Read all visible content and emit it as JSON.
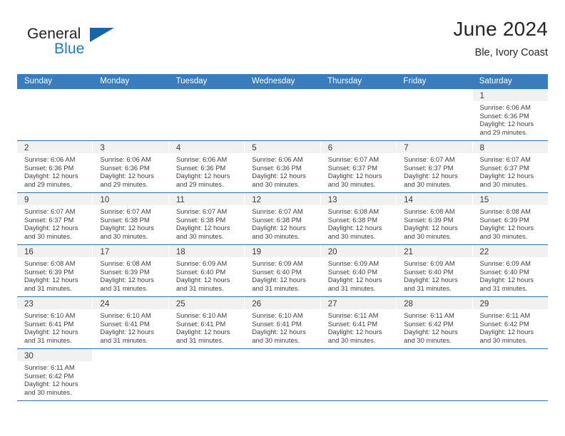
{
  "brand": {
    "name_part1": "General",
    "name_part2": "Blue",
    "flag_icon": "blue-triangle-flag-icon"
  },
  "header": {
    "title": "June 2024",
    "subtitle": "Ble, Ivory Coast"
  },
  "colors": {
    "header_blue": "#3a7dbf",
    "rule_blue": "#2f6fa8",
    "brand_blue": "#1f7ac0",
    "day_band_gray": "#f1f1f1",
    "text": "#3f3f3f"
  },
  "weekday_headers": [
    "Sunday",
    "Monday",
    "Tuesday",
    "Wednesday",
    "Thursday",
    "Friday",
    "Saturday"
  ],
  "weeks": [
    [
      {
        "day": "",
        "sunrise": "",
        "sunset": "",
        "daylight1": "",
        "daylight2": "",
        "blank": true
      },
      {
        "day": "",
        "sunrise": "",
        "sunset": "",
        "daylight1": "",
        "daylight2": "",
        "blank": true
      },
      {
        "day": "",
        "sunrise": "",
        "sunset": "",
        "daylight1": "",
        "daylight2": "",
        "blank": true
      },
      {
        "day": "",
        "sunrise": "",
        "sunset": "",
        "daylight1": "",
        "daylight2": "",
        "blank": true
      },
      {
        "day": "",
        "sunrise": "",
        "sunset": "",
        "daylight1": "",
        "daylight2": "",
        "blank": true
      },
      {
        "day": "",
        "sunrise": "",
        "sunset": "",
        "daylight1": "",
        "daylight2": "",
        "blank": true
      },
      {
        "day": "1",
        "sunrise": "Sunrise: 6:06 AM",
        "sunset": "Sunset: 6:36 PM",
        "daylight1": "Daylight: 12 hours",
        "daylight2": "and 29 minutes.",
        "blank": false
      }
    ],
    [
      {
        "day": "2",
        "sunrise": "Sunrise: 6:06 AM",
        "sunset": "Sunset: 6:36 PM",
        "daylight1": "Daylight: 12 hours",
        "daylight2": "and 29 minutes.",
        "blank": false
      },
      {
        "day": "3",
        "sunrise": "Sunrise: 6:06 AM",
        "sunset": "Sunset: 6:36 PM",
        "daylight1": "Daylight: 12 hours",
        "daylight2": "and 29 minutes.",
        "blank": false
      },
      {
        "day": "4",
        "sunrise": "Sunrise: 6:06 AM",
        "sunset": "Sunset: 6:36 PM",
        "daylight1": "Daylight: 12 hours",
        "daylight2": "and 29 minutes.",
        "blank": false
      },
      {
        "day": "5",
        "sunrise": "Sunrise: 6:06 AM",
        "sunset": "Sunset: 6:36 PM",
        "daylight1": "Daylight: 12 hours",
        "daylight2": "and 30 minutes.",
        "blank": false
      },
      {
        "day": "6",
        "sunrise": "Sunrise: 6:07 AM",
        "sunset": "Sunset: 6:37 PM",
        "daylight1": "Daylight: 12 hours",
        "daylight2": "and 30 minutes.",
        "blank": false
      },
      {
        "day": "7",
        "sunrise": "Sunrise: 6:07 AM",
        "sunset": "Sunset: 6:37 PM",
        "daylight1": "Daylight: 12 hours",
        "daylight2": "and 30 minutes.",
        "blank": false
      },
      {
        "day": "8",
        "sunrise": "Sunrise: 6:07 AM",
        "sunset": "Sunset: 6:37 PM",
        "daylight1": "Daylight: 12 hours",
        "daylight2": "and 30 minutes.",
        "blank": false
      }
    ],
    [
      {
        "day": "9",
        "sunrise": "Sunrise: 6:07 AM",
        "sunset": "Sunset: 6:37 PM",
        "daylight1": "Daylight: 12 hours",
        "daylight2": "and 30 minutes.",
        "blank": false
      },
      {
        "day": "10",
        "sunrise": "Sunrise: 6:07 AM",
        "sunset": "Sunset: 6:38 PM",
        "daylight1": "Daylight: 12 hours",
        "daylight2": "and 30 minutes.",
        "blank": false
      },
      {
        "day": "11",
        "sunrise": "Sunrise: 6:07 AM",
        "sunset": "Sunset: 6:38 PM",
        "daylight1": "Daylight: 12 hours",
        "daylight2": "and 30 minutes.",
        "blank": false
      },
      {
        "day": "12",
        "sunrise": "Sunrise: 6:07 AM",
        "sunset": "Sunset: 6:38 PM",
        "daylight1": "Daylight: 12 hours",
        "daylight2": "and 30 minutes.",
        "blank": false
      },
      {
        "day": "13",
        "sunrise": "Sunrise: 6:08 AM",
        "sunset": "Sunset: 6:38 PM",
        "daylight1": "Daylight: 12 hours",
        "daylight2": "and 30 minutes.",
        "blank": false
      },
      {
        "day": "14",
        "sunrise": "Sunrise: 6:08 AM",
        "sunset": "Sunset: 6:39 PM",
        "daylight1": "Daylight: 12 hours",
        "daylight2": "and 30 minutes.",
        "blank": false
      },
      {
        "day": "15",
        "sunrise": "Sunrise: 6:08 AM",
        "sunset": "Sunset: 6:39 PM",
        "daylight1": "Daylight: 12 hours",
        "daylight2": "and 30 minutes.",
        "blank": false
      }
    ],
    [
      {
        "day": "16",
        "sunrise": "Sunrise: 6:08 AM",
        "sunset": "Sunset: 6:39 PM",
        "daylight1": "Daylight: 12 hours",
        "daylight2": "and 31 minutes.",
        "blank": false
      },
      {
        "day": "17",
        "sunrise": "Sunrise: 6:08 AM",
        "sunset": "Sunset: 6:39 PM",
        "daylight1": "Daylight: 12 hours",
        "daylight2": "and 31 minutes.",
        "blank": false
      },
      {
        "day": "18",
        "sunrise": "Sunrise: 6:09 AM",
        "sunset": "Sunset: 6:40 PM",
        "daylight1": "Daylight: 12 hours",
        "daylight2": "and 31 minutes.",
        "blank": false
      },
      {
        "day": "19",
        "sunrise": "Sunrise: 6:09 AM",
        "sunset": "Sunset: 6:40 PM",
        "daylight1": "Daylight: 12 hours",
        "daylight2": "and 31 minutes.",
        "blank": false
      },
      {
        "day": "20",
        "sunrise": "Sunrise: 6:09 AM",
        "sunset": "Sunset: 6:40 PM",
        "daylight1": "Daylight: 12 hours",
        "daylight2": "and 31 minutes.",
        "blank": false
      },
      {
        "day": "21",
        "sunrise": "Sunrise: 6:09 AM",
        "sunset": "Sunset: 6:40 PM",
        "daylight1": "Daylight: 12 hours",
        "daylight2": "and 31 minutes.",
        "blank": false
      },
      {
        "day": "22",
        "sunrise": "Sunrise: 6:09 AM",
        "sunset": "Sunset: 6:40 PM",
        "daylight1": "Daylight: 12 hours",
        "daylight2": "and 31 minutes.",
        "blank": false
      }
    ],
    [
      {
        "day": "23",
        "sunrise": "Sunrise: 6:10 AM",
        "sunset": "Sunset: 6:41 PM",
        "daylight1": "Daylight: 12 hours",
        "daylight2": "and 31 minutes.",
        "blank": false
      },
      {
        "day": "24",
        "sunrise": "Sunrise: 6:10 AM",
        "sunset": "Sunset: 6:41 PM",
        "daylight1": "Daylight: 12 hours",
        "daylight2": "and 31 minutes.",
        "blank": false
      },
      {
        "day": "25",
        "sunrise": "Sunrise: 6:10 AM",
        "sunset": "Sunset: 6:41 PM",
        "daylight1": "Daylight: 12 hours",
        "daylight2": "and 31 minutes.",
        "blank": false
      },
      {
        "day": "26",
        "sunrise": "Sunrise: 6:10 AM",
        "sunset": "Sunset: 6:41 PM",
        "daylight1": "Daylight: 12 hours",
        "daylight2": "and 30 minutes.",
        "blank": false
      },
      {
        "day": "27",
        "sunrise": "Sunrise: 6:11 AM",
        "sunset": "Sunset: 6:41 PM",
        "daylight1": "Daylight: 12 hours",
        "daylight2": "and 30 minutes.",
        "blank": false
      },
      {
        "day": "28",
        "sunrise": "Sunrise: 6:11 AM",
        "sunset": "Sunset: 6:42 PM",
        "daylight1": "Daylight: 12 hours",
        "daylight2": "and 30 minutes.",
        "blank": false
      },
      {
        "day": "29",
        "sunrise": "Sunrise: 6:11 AM",
        "sunset": "Sunset: 6:42 PM",
        "daylight1": "Daylight: 12 hours",
        "daylight2": "and 30 minutes.",
        "blank": false
      }
    ],
    [
      {
        "day": "30",
        "sunrise": "Sunrise: 6:11 AM",
        "sunset": "Sunset: 6:42 PM",
        "daylight1": "Daylight: 12 hours",
        "daylight2": "and 30 minutes.",
        "blank": false
      },
      {
        "day": "",
        "sunrise": "",
        "sunset": "",
        "daylight1": "",
        "daylight2": "",
        "blank": true
      },
      {
        "day": "",
        "sunrise": "",
        "sunset": "",
        "daylight1": "",
        "daylight2": "",
        "blank": true
      },
      {
        "day": "",
        "sunrise": "",
        "sunset": "",
        "daylight1": "",
        "daylight2": "",
        "blank": true
      },
      {
        "day": "",
        "sunrise": "",
        "sunset": "",
        "daylight1": "",
        "daylight2": "",
        "blank": true
      },
      {
        "day": "",
        "sunrise": "",
        "sunset": "",
        "daylight1": "",
        "daylight2": "",
        "blank": true
      },
      {
        "day": "",
        "sunrise": "",
        "sunset": "",
        "daylight1": "",
        "daylight2": "",
        "blank": true
      }
    ]
  ]
}
